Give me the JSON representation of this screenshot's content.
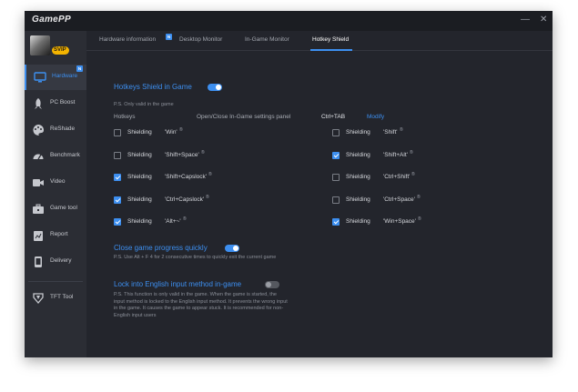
{
  "app": {
    "logo": "GamePP",
    "vip": "SVIP",
    "minimize": "—",
    "close": "✕"
  },
  "sidebar": {
    "items": [
      {
        "label": "Hardware",
        "icon": "monitor-icon",
        "badge": "N"
      },
      {
        "label": "PC Boost",
        "icon": "rocket-icon"
      },
      {
        "label": "ReShade",
        "icon": "palette-icon"
      },
      {
        "label": "Benchmark",
        "icon": "gauge-icon"
      },
      {
        "label": "Video",
        "icon": "camera-icon"
      },
      {
        "label": "Game tool",
        "icon": "toolbox-icon"
      },
      {
        "label": "Report",
        "icon": "report-icon"
      },
      {
        "label": "Delivery",
        "icon": "phone-icon"
      }
    ],
    "extra": {
      "label": "TFT Tool",
      "icon": "tft-icon"
    }
  },
  "tabs": {
    "items": [
      "Hardware information",
      "Desktop Monitor",
      "In-Game Monitor",
      "Hotkey Shield"
    ],
    "badge": "N",
    "active": 3
  },
  "hotkey_shield": {
    "title": "Hotkeys Shield in Game",
    "enabled": true,
    "note": "P.S. Only valid in the game",
    "hotkeys_label": "Hotkeys",
    "panel_label": "Open/Close In-Game settings panel",
    "panel_key": "Ctrl+TAB",
    "modify": "Modify",
    "shield_word": "Shielding",
    "left": [
      {
        "key": "'Win'",
        "checked": false
      },
      {
        "key": "'Shift+Space'",
        "checked": false
      },
      {
        "key": "'Shift+Capslock'",
        "checked": true
      },
      {
        "key": "'Ctrl+Capslock'",
        "checked": true
      },
      {
        "key": "'Alt+~'",
        "checked": true
      }
    ],
    "right": [
      {
        "key": "'Shift'",
        "checked": false
      },
      {
        "key": "'Shift+Alt'",
        "checked": true
      },
      {
        "key": "'Ctrl+Shift'",
        "checked": false
      },
      {
        "key": "'Ctrl+Space'",
        "checked": false
      },
      {
        "key": "'Win+Space'",
        "checked": true
      }
    ],
    "mark": "®"
  },
  "close_game": {
    "title": "Close game progress quickly",
    "enabled": true,
    "note": "P.S. Use Alt + F 4 for 2 consecutive times to quickly exit the current game"
  },
  "lock_english": {
    "title": "Lock into English input method in-game",
    "enabled": false,
    "note": "P.S. This function is only valid in the game. When the game is started, the input method is locked to the English input method. It prevents the wrong input in the game. It causes the game to appear stuck. It is recommended for non-English input users"
  },
  "colors": {
    "accent": "#3d8ff0",
    "bg": "#23252c",
    "sidebar": "#2b2d34"
  }
}
